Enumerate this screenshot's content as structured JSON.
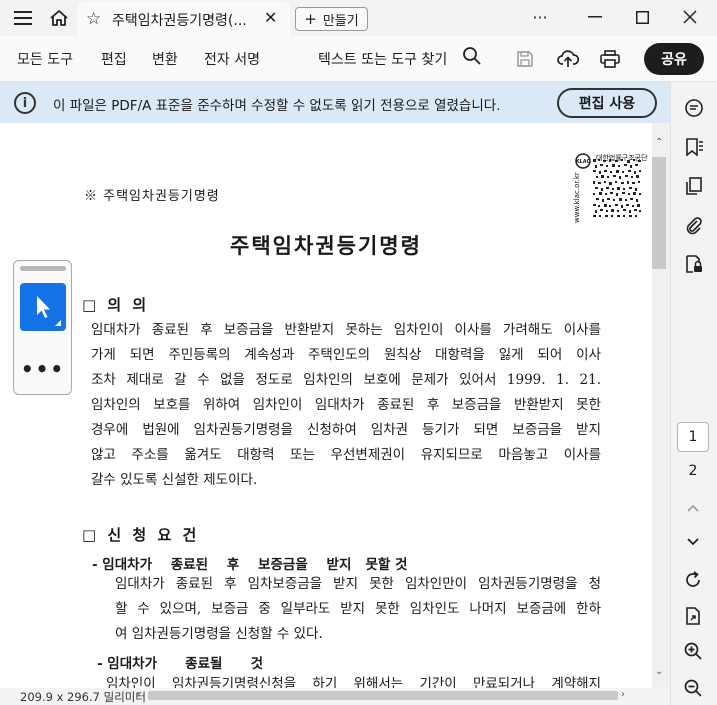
{
  "titlebar": {
    "tab_title": "주택임차권등기명령(...",
    "new_tab_label": "만들기",
    "more_label": "···"
  },
  "toolbar": {
    "menu": [
      "모든 도구",
      "편집",
      "변환",
      "전자 서명"
    ],
    "find_label": "텍스트 또는 도구 찾기",
    "share_label": "공유"
  },
  "banner": {
    "message": "이 파일은 PDF/A 표준을 준수하며 수정할 수 없도록 읽기 전용으로 열렸습니다.",
    "edit_button": "편집 사용"
  },
  "navigation": {
    "current_page": "1",
    "total_pages": "2"
  },
  "status": {
    "page_size": "209.9 x 296.7 밀리미터"
  },
  "document": {
    "header_small": "※   주택임차권등기명령",
    "title": "주택임차권등기명령",
    "qr_label": "대한법률구조공단",
    "qr_url": "www.klac.or.kr",
    "section1_heading": "□ 의  의",
    "section1_lines": [
      "임대차가 종료된 후 보증금을 반환받지 못하는 임차인이 이사를 가려해도 이사를",
      "가게 되면 주민등록의 계속성과 주택인도의 원칙상 대항력을 잃게 되어 이사",
      "조차 제대로 갈 수 없을 정도로 임차인의 보호에 문제가 있어서 1999. 1. 21.",
      "임차인의 보호를 위하여 임차인이 임대차가 종료된 후 보증금을 반환받지 못한",
      "경우에 법원에 임차권등기명령을 신청하여 임차권 등기가 되면 보증금을 받지",
      "않고 주소를 옮겨도 대항력 또는 우선변제권이 유지되므로 마음놓고 이사를",
      "갈수 있도록 신설한 제도이다."
    ],
    "section2_heading": "□ 신 청 요 건",
    "sub1": "- 임대차가    종료된    후    보증금을    받지   못할 것",
    "sub1_lines": [
      "임대차가 종료된 후 임차보증금을 받지 못한 임차인만이 임차권등기명령을 청",
      "할 수 있으며, 보증금 중 일부라도 받지 못한 임차인도 나머지 보증금에 한하",
      "여 임차권등기명령을 신청할 수 있다."
    ],
    "sub2": "- 임대차가      종료될      것",
    "sub2_partial": "임차인이 임차권등기명령신청을 하기 위해서는 기간이 만료되거나 계약해지"
  }
}
